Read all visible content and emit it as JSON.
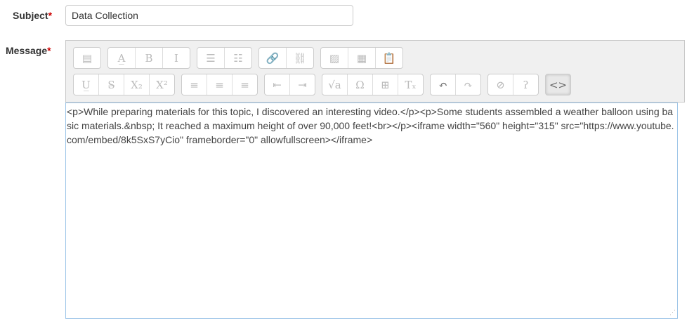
{
  "subject": {
    "label": "Subject",
    "required_mark": "*",
    "value": "Data Collection"
  },
  "message": {
    "label": "Message",
    "required_mark": "*",
    "html_source": "<p>While preparing materials for this topic, I discovered an interesting video.</p><p>Some students assembled a weather balloon using basic materials.&nbsp; It reached a maximum height of over 90,000 feet!<br></p><iframe width=\"560\" height=\"315\" src=\"https://www.youtube.com/embed/8k5SxS7yCio\" frameborder=\"0\" allowfullscreen></iframe>"
  },
  "toolbar": {
    "row1": [
      [
        "toolbar-toggle-icon"
      ],
      [
        "font-size-icon",
        "bold-icon",
        "italic-icon"
      ],
      [
        "bullet-list-icon",
        "numbered-list-icon"
      ],
      [
        "link-icon",
        "unlink-icon"
      ],
      [
        "image-icon",
        "media-icon",
        "paste-icon"
      ]
    ],
    "row2": [
      [
        "underline-icon",
        "strikethrough-icon",
        "subscript-icon",
        "superscript-icon"
      ],
      [
        "align-left-icon",
        "align-center-icon",
        "align-right-icon"
      ],
      [
        "outdent-icon",
        "indent-icon"
      ],
      [
        "equation-icon",
        "special-character-icon",
        "table-icon",
        "clear-formatting-icon"
      ],
      [
        "undo-icon",
        "redo-icon"
      ],
      [
        "screenreader-helper-icon",
        "accessibility-checker-icon"
      ],
      [
        "html-source-icon"
      ]
    ],
    "active": "html-source-icon"
  }
}
